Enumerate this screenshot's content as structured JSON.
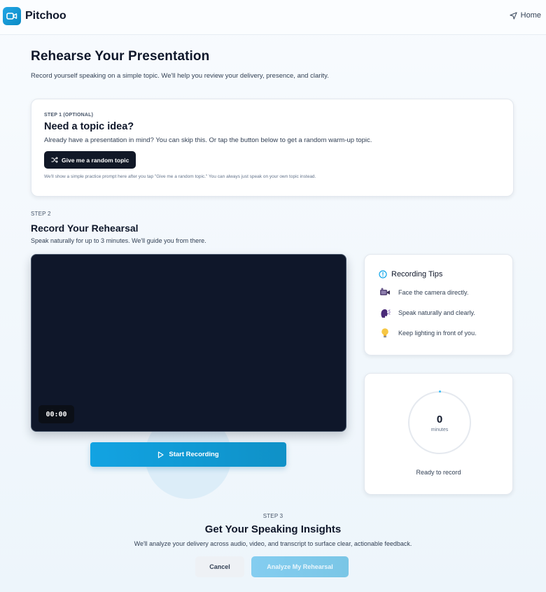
{
  "app": {
    "name": "Pitchoo",
    "logo_icon": "video-camera-icon",
    "nav_home": "Home",
    "nav_home_icon": "navigation-arrow-icon"
  },
  "hero": {
    "title": "Rehearse Your Presentation",
    "subtitle": "Record yourself speaking on a simple topic. We'll help you review your delivery, presence, and clarity."
  },
  "step1": {
    "eyebrow": "STEP 1 (OPTIONAL)",
    "title": "Need a topic idea?",
    "description": "Already have a presentation in mind? You can skip this. Or tap the button below to get a random warm-up topic.",
    "button_label": "Give me a random topic",
    "button_icon": "shuffle-icon",
    "note": "We'll show a simple practice prompt here after you tap \"Give me a random topic.\" You can always just speak on your own topic instead."
  },
  "step2": {
    "eyebrow": "STEP 2",
    "title": "Record Your Rehearsal",
    "description": "Speak naturally for up to 3 minutes. We'll guide you from there.",
    "timer": "00:00",
    "record_button": "Start Recording",
    "record_icon": "play-icon"
  },
  "tips": {
    "title": "Recording Tips",
    "icon": "info-icon",
    "items": [
      {
        "text": "Face the camera directly.",
        "icon": "video-camera-emoji-icon"
      },
      {
        "text": "Speak naturally and clearly.",
        "icon": "speaking-head-icon"
      },
      {
        "text": "Keep lighting in front of you.",
        "icon": "light-bulb-icon"
      }
    ]
  },
  "meter": {
    "value": "0",
    "unit": "minutes",
    "status": "Ready to record"
  },
  "step3": {
    "eyebrow": "STEP 3",
    "title": "Get Your Speaking Insights",
    "description": "We'll analyze your delivery across audio, video, and transcript to surface clear, actionable feedback.",
    "cancel_button": "Cancel",
    "analyze_button": "Analyze My Rehearsal"
  },
  "colors": {
    "brand": "#0ea5e9",
    "dark_button": "#111827",
    "video_bg": "#0f172a",
    "analyze_disabled": "#7dc9ea"
  }
}
